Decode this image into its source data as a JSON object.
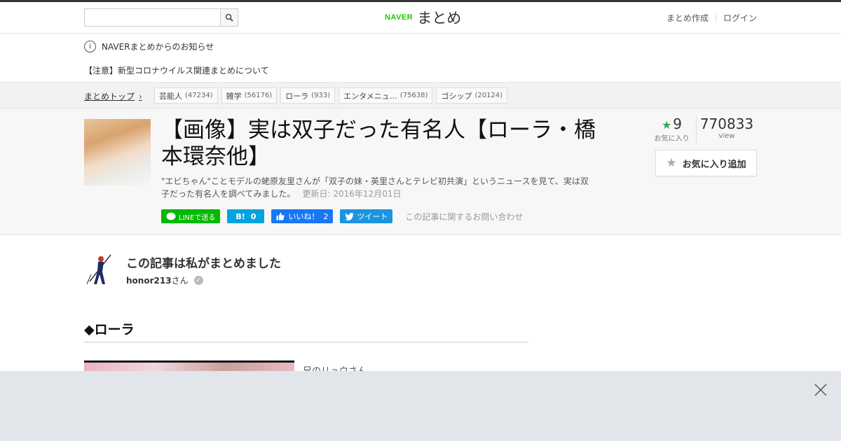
{
  "header": {
    "search_placeholder": "",
    "logo_brand": "NAVER",
    "logo_product": "まとめ",
    "links": [
      "まとめ作成",
      "ログイン"
    ]
  },
  "notice": {
    "heading": "NAVERまとめからのお知らせ",
    "item": "【注意】新型コロナウイルス関連まとめについて"
  },
  "categories": {
    "breadcrumb": "まとめトップ",
    "tags": [
      {
        "label": "芸能人",
        "count": "(47234)"
      },
      {
        "label": "雑学",
        "count": "(56176)"
      },
      {
        "label": "ローラ",
        "count": "(933)"
      },
      {
        "label": "エンタメニュ…",
        "count": "(75638)"
      },
      {
        "label": "ゴシップ",
        "count": "(20124)"
      }
    ]
  },
  "article": {
    "title": "【画像】実は双子だった有名人【ローラ・橋本環奈他】",
    "description": "\"エビちゃん\"ことモデルの蛯原友里さんが「双子の妹・英里さんとテレビ初共演」というニュースを見て、実は双子だった有名人を調べてみました。",
    "updated": "更新日: 2016年12月01日",
    "favorites_count": "9",
    "favorites_label": "お気に入り",
    "views_count": "770833",
    "views_label": "view",
    "favorite_button": "お気に入り追加",
    "contact_link": "この記事に関するお問い合わせ"
  },
  "share": {
    "line": "LINEで送る",
    "hatena_icon": "B!",
    "hatena_count": "0",
    "facebook": "いいね！",
    "facebook_count": "2",
    "twitter": "ツイート"
  },
  "author": {
    "title": "この記事は私がまとめました",
    "name": "honor213",
    "suffix": "さん"
  },
  "section": {
    "heading": "◆ローラ",
    "caption": "兄のリュウさん"
  },
  "colors": {
    "line_green": "#00b900",
    "hatena_blue": "#00a4de",
    "facebook_blue": "#1877f2",
    "twitter_blue": "#1b95e0",
    "naver_green": "#1ec800"
  }
}
